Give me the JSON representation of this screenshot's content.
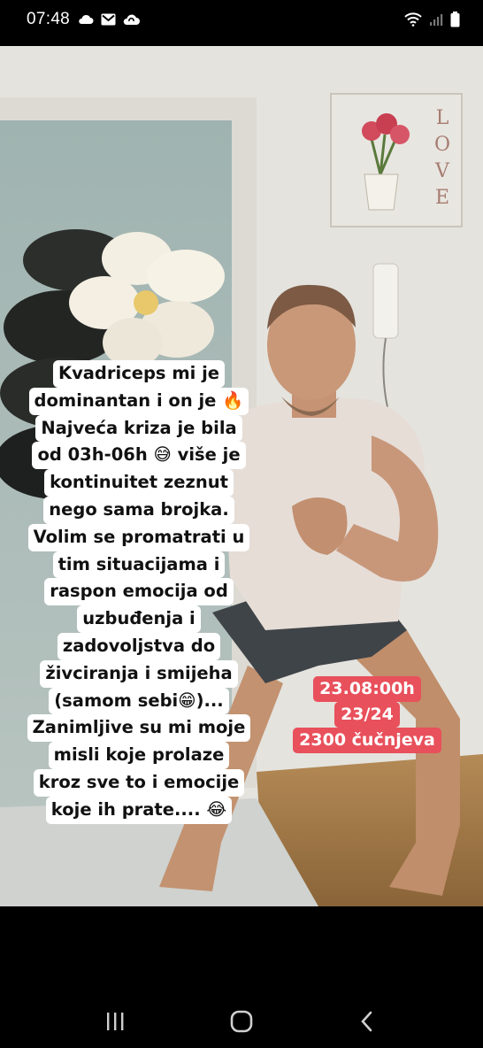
{
  "status_bar": {
    "time": "07:48",
    "left_icons": [
      "cloud-icon",
      "gmail-icon",
      "cloud-sync-icon"
    ],
    "right_icons": [
      "wifi-icon",
      "signal-icon",
      "battery-icon"
    ]
  },
  "story": {
    "caption_lines": [
      "Kvadriceps mi je",
      "dominantan i on je 🔥",
      "Najveća kriza je bila",
      "od 03h-06h 😅 više je",
      "kontinuitet zeznut",
      "nego sama brojka.",
      "Volim se promatrati u",
      "tim situacijama i",
      "raspon emocija od",
      "uzbuđenja i",
      "zadovoljstva do",
      "živciranja i smijeha",
      "(samom sebi😁)...",
      "Zanimljive su mi moje",
      "misli koje prolaze",
      "kroz sve to i emocije",
      "koje ih prate.... 😂"
    ],
    "tag_lines": [
      "23.08:00h",
      "23/24",
      "2300 čučnjeva"
    ],
    "tag_color": "#e8505b",
    "wall_art_text": "LOVE"
  },
  "nav_bar": {
    "buttons": [
      "recent-apps-icon",
      "home-icon",
      "back-icon"
    ]
  }
}
